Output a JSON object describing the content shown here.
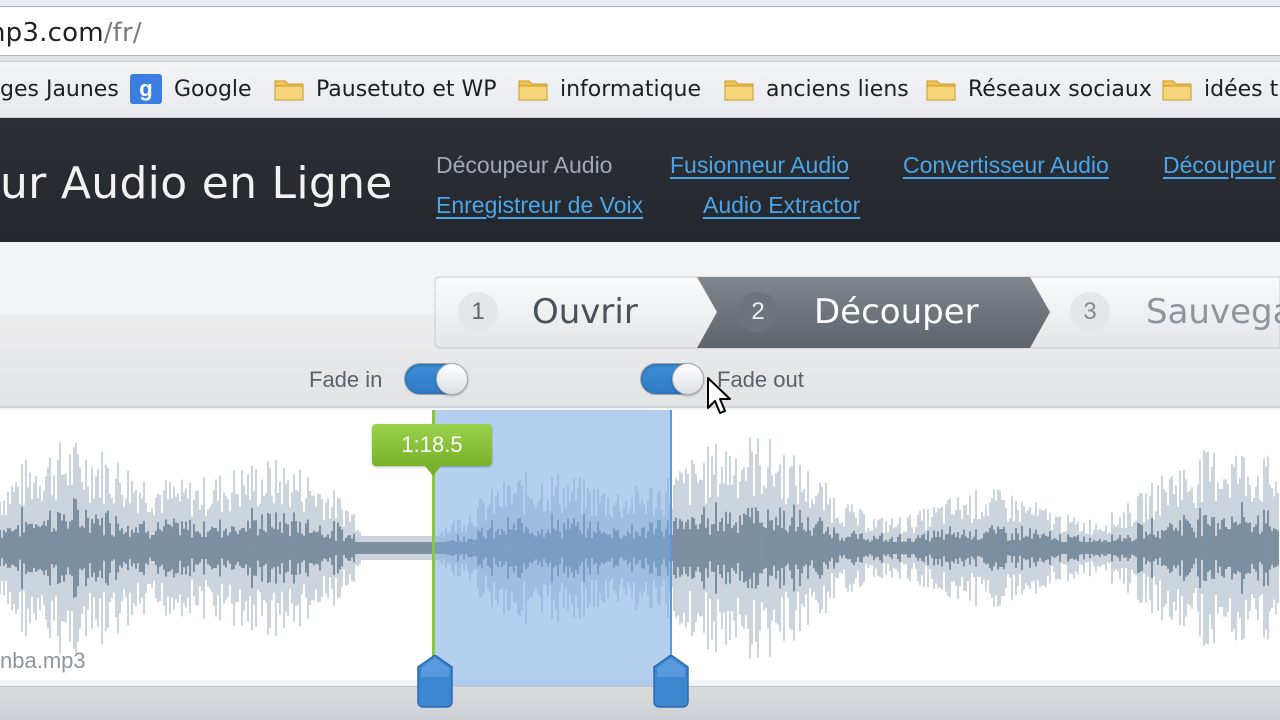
{
  "browser": {
    "url_main": "np3.com",
    "url_path": "/fr/",
    "bookmarks": [
      {
        "label": "ges Jaunes",
        "icon": "none"
      },
      {
        "label": "Google",
        "icon": "google-icon"
      },
      {
        "label": "Pausetuto et WP",
        "icon": "folder-icon"
      },
      {
        "label": "informatique",
        "icon": "folder-icon"
      },
      {
        "label": "anciens liens",
        "icon": "folder-icon"
      },
      {
        "label": "Réseaux sociaux",
        "icon": "folder-icon"
      },
      {
        "label": "idées tu",
        "icon": "folder-icon"
      }
    ],
    "google_letter": "g"
  },
  "site": {
    "title": "ur Audio en Ligne",
    "nav": [
      {
        "label": "Découpeur Audio",
        "active": true
      },
      {
        "label": "Fusionneur Audio",
        "active": false
      },
      {
        "label": "Convertisseur Audio",
        "active": false
      },
      {
        "label": "Découpeur",
        "active": false
      },
      {
        "label": "Enregistreur de Voix",
        "active": false
      },
      {
        "label": "Audio Extractor",
        "active": false
      }
    ]
  },
  "steps": [
    {
      "number": "1",
      "label": "Ouvrir"
    },
    {
      "number": "2",
      "label": "Découper"
    },
    {
      "number": "3",
      "label": "Sauvega"
    }
  ],
  "fades": {
    "fade_in_label": "Fade in",
    "fade_in_on": true,
    "fade_out_label": "Fade out",
    "fade_out_on": true
  },
  "editor": {
    "marker_time": "1:18.5",
    "filename": "nba.mp3"
  },
  "colors": {
    "accent_blue": "#3e8fd8",
    "marker_green": "#8cc63f",
    "header_dark": "#2c3036",
    "link_blue": "#4aa6e8"
  }
}
